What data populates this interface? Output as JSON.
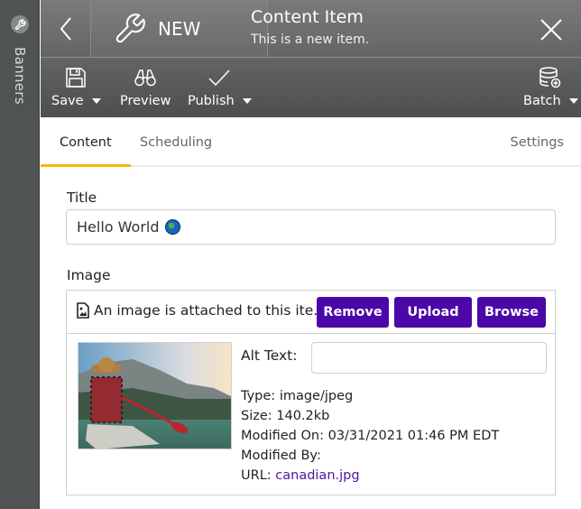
{
  "sidebar": {
    "label": "Banners",
    "icon": "wrench-icon"
  },
  "header": {
    "back_icon": "chevron-left-icon",
    "mode_icon": "wrench-icon",
    "mode_label": "NEW",
    "title": "Content Item",
    "subtitle": "This is a new item.",
    "close_icon": "close-icon"
  },
  "toolbar": {
    "save_label": "Save",
    "preview_label": "Preview",
    "publish_label": "Publish",
    "batch_label": "Batch"
  },
  "tabs": {
    "items": [
      {
        "label": "Content",
        "active": true
      },
      {
        "label": "Scheduling",
        "active": false
      },
      {
        "label": "Settings",
        "active": false
      }
    ],
    "accent_color": "#f2b90f"
  },
  "form": {
    "title_label": "Title",
    "title_value": "Hello World",
    "title_emoji": "globe-americas",
    "image_label": "Image",
    "image_message": "An image is attached to this ite...",
    "buttons": {
      "remove": "Remove",
      "upload": "Upload",
      "browse": "Browse"
    },
    "button_color": "#4b07a8",
    "alt_text_label": "Alt Text:",
    "alt_text_value": "",
    "meta": {
      "type_label": "Type:",
      "type_value": "image/jpeg",
      "size_label": "Size:",
      "size_value": "140.2kb",
      "modified_on_label": "Modified On:",
      "modified_on_value": "03/31/2021 01:46 PM EDT",
      "modified_by_label": "Modified By:",
      "modified_by_value": "",
      "url_label": "URL:",
      "url_value": "canadian.jpg"
    }
  }
}
